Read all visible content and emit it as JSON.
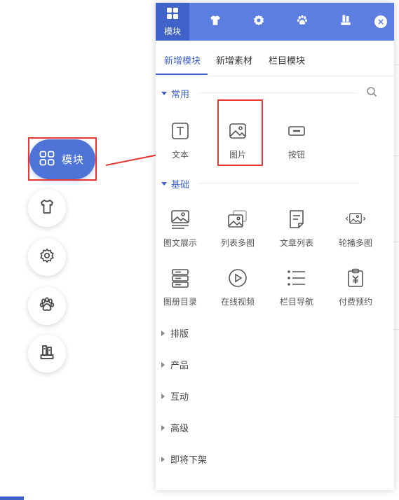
{
  "float_menu": {
    "module_label": "模块"
  },
  "panel": {
    "header_tabs": [
      {
        "label": "模块",
        "icon": "grid-icon"
      },
      {
        "label": "",
        "icon": "shirt-icon"
      },
      {
        "label": "",
        "icon": "gear-icon"
      },
      {
        "label": "",
        "icon": "paw-icon"
      },
      {
        "label": "",
        "icon": "books-icon"
      }
    ],
    "close_symbol": "×",
    "sub_tabs": [
      "新增模块",
      "新增素材",
      "栏目模块"
    ],
    "sections": {
      "common": {
        "title": "常用",
        "items": [
          {
            "label": "文本",
            "icon": "text-icon"
          },
          {
            "label": "图片",
            "icon": "image-icon"
          },
          {
            "label": "按钮",
            "icon": "button-icon"
          }
        ]
      },
      "basic": {
        "title": "基础",
        "items": [
          {
            "label": "图文展示",
            "icon": "image-text-icon"
          },
          {
            "label": "列表多图",
            "icon": "multi-image-icon"
          },
          {
            "label": "文章列表",
            "icon": "article-list-icon"
          },
          {
            "label": "轮播多图",
            "icon": "carousel-icon"
          },
          {
            "label": "图册目录",
            "icon": "album-icon"
          },
          {
            "label": "在线视频",
            "icon": "video-play-icon"
          },
          {
            "label": "栏目导航",
            "icon": "nav-list-icon"
          },
          {
            "label": "付费预约",
            "icon": "paid-booking-icon"
          }
        ]
      },
      "collapsed": [
        "排版",
        "产品",
        "互动",
        "高级",
        "即将下架"
      ]
    }
  },
  "colors": {
    "accent": "#3f63c8",
    "header": "#5b7ee0",
    "highlight_frame": "#e53935"
  }
}
